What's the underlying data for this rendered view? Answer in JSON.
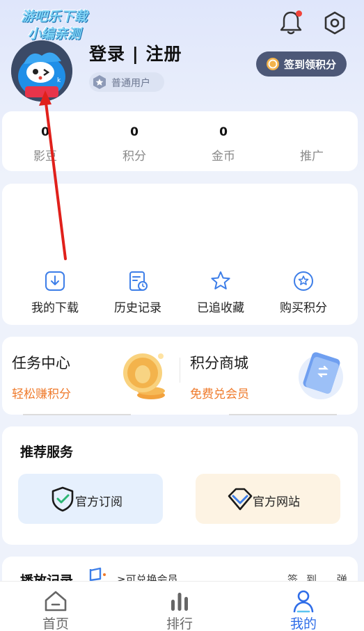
{
  "watermark": {
    "line1": "游吧乐下载",
    "line2": "小编亲测"
  },
  "header": {
    "login_label": "登录 | 注册",
    "user_level": "普通用户",
    "checkin_label": "签到领积分"
  },
  "stats": [
    {
      "value": "0",
      "label": "影豆"
    },
    {
      "value": "0",
      "label": "积分"
    },
    {
      "value": "0",
      "label": "金币"
    },
    {
      "value": "",
      "label": "推广"
    }
  ],
  "quick_actions": [
    {
      "label": "我的下载",
      "icon": "download-icon"
    },
    {
      "label": "历史记录",
      "icon": "history-icon"
    },
    {
      "label": "已追收藏",
      "icon": "star-icon"
    },
    {
      "label": "购买积分",
      "icon": "star-badge-icon"
    }
  ],
  "promo": {
    "tasks_title": "任务中心",
    "tasks_sub": "轻松赚积分",
    "mall_title": "积分商城",
    "mall_sub": "免费兑会员"
  },
  "services": {
    "title": "推荐服务",
    "items": [
      {
        "label": "官方订阅",
        "icon": "shield-check-icon"
      },
      {
        "label": "官方网站",
        "icon": "diamond-icon"
      }
    ]
  },
  "history": {
    "title": "播放记录",
    "note": "≥可兑换会员",
    "right": "签到 弹"
  },
  "tabbar": [
    {
      "label": "首页",
      "icon": "home-icon",
      "active": false
    },
    {
      "label": "排行",
      "icon": "ranking-icon",
      "active": false
    },
    {
      "label": "我的",
      "icon": "profile-icon",
      "active": true
    }
  ],
  "colors": {
    "accent": "#2f6de8",
    "orange": "#ef7a2b",
    "checkin_bg": "#4d5877",
    "annotation": "#e0201b"
  }
}
